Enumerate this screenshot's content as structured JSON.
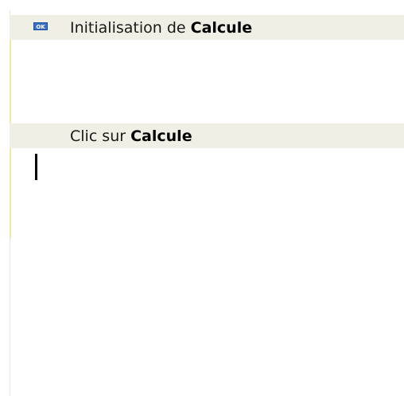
{
  "sections": [
    {
      "status_badge": "OK",
      "title_prefix": "Initialisation de ",
      "title_bold": "Calcule"
    },
    {
      "status_badge": "",
      "title_prefix": "Clic sur ",
      "title_bold": "Calcule"
    }
  ],
  "colors": {
    "header_background": "#f0efe6",
    "section_bar": "#f3e9a7",
    "badge": "#3a6fc8"
  },
  "icons": {
    "status": "ok-badge-icon"
  }
}
